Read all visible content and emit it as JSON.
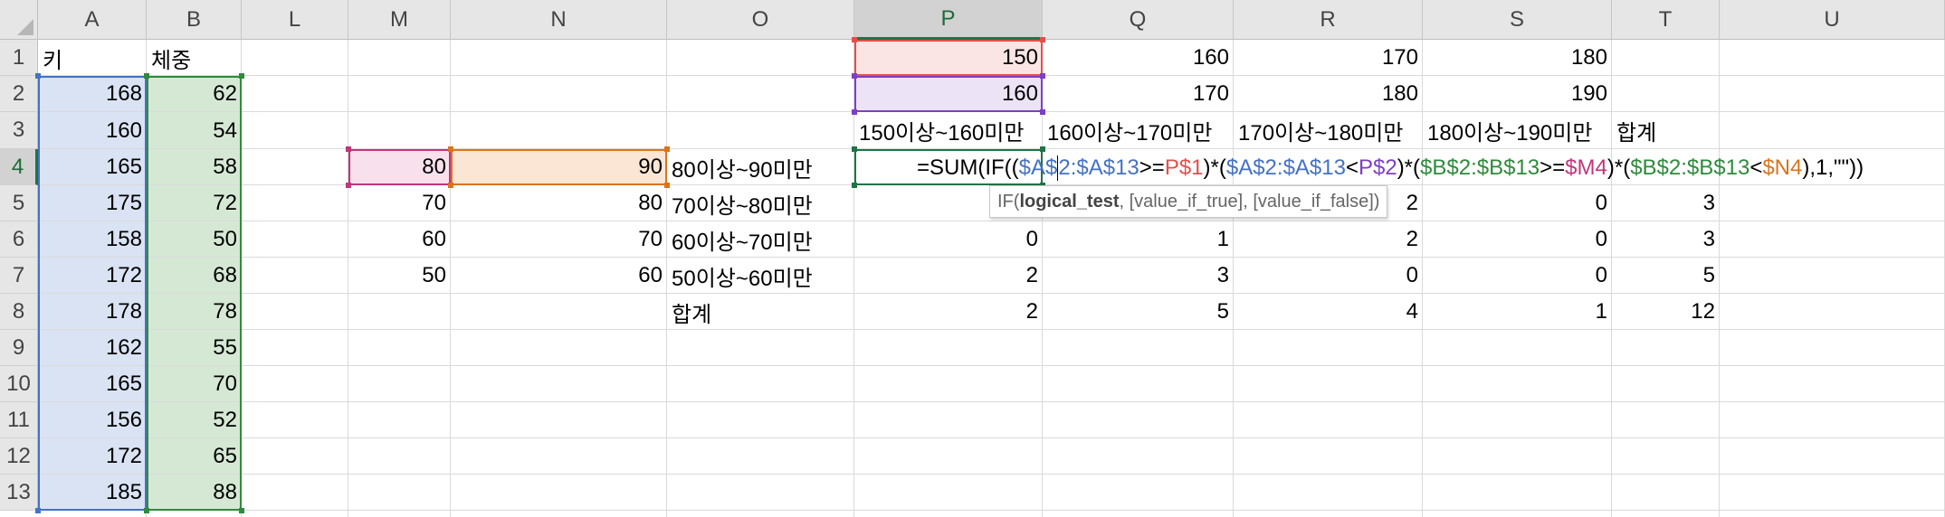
{
  "columns": [
    "A",
    "B",
    "L",
    "M",
    "N",
    "O",
    "P",
    "Q",
    "R",
    "S",
    "T",
    "U"
  ],
  "rows": [
    "1",
    "2",
    "3",
    "4",
    "5",
    "6",
    "7",
    "8",
    "9",
    "10",
    "11",
    "12",
    "13"
  ],
  "cells": {
    "A1": "키",
    "B1": "체중",
    "A2": "168",
    "B2": "62",
    "A3": "160",
    "B3": "54",
    "A4": "165",
    "B4": "58",
    "A5": "175",
    "B5": "72",
    "A6": "158",
    "B6": "50",
    "A7": "172",
    "B7": "68",
    "A8": "178",
    "B8": "78",
    "A9": "162",
    "B9": "55",
    "A10": "165",
    "B10": "70",
    "A11": "156",
    "B11": "52",
    "A12": "172",
    "B12": "65",
    "A13": "185",
    "B13": "88",
    "P1": "150",
    "Q1": "160",
    "R1": "170",
    "S1": "180",
    "P2": "160",
    "Q2": "170",
    "R2": "180",
    "S2": "190",
    "P3": "150이상~160미만",
    "Q3": "160이상~170미만",
    "R3": "170이상~180미만",
    "S3": "180이상~190미만",
    "T3": "합계",
    "M4": "80",
    "N4": "90",
    "O4": "80이상~90미만",
    "M5": "70",
    "N5": "80",
    "O5": "70이상~80미만",
    "R5": "2",
    "S5": "0",
    "T5": "3",
    "M6": "60",
    "N6": "70",
    "O6": "60이상~70미만",
    "P6": "0",
    "Q6": "1",
    "R6": "2",
    "S6": "0",
    "T6": "3",
    "M7": "50",
    "N7": "60",
    "O7": "50이상~60미만",
    "P7": "2",
    "Q7": "3",
    "R7": "0",
    "S7": "0",
    "T7": "5",
    "O8": "합계",
    "P8": "2",
    "Q8": "5",
    "R8": "4",
    "S8": "1",
    "T8": "12"
  },
  "active_cell": "P4",
  "formula": {
    "parts": [
      {
        "text": "=SUM(IF((",
        "color": "#000000"
      },
      {
        "text": "$A$",
        "color": "#4472c4"
      },
      {
        "caret": true
      },
      {
        "text": "2:$A$13",
        "color": "#4472c4"
      },
      {
        "text": ">=",
        "color": "#000000"
      },
      {
        "text": "P$1",
        "color": "#e2504c"
      },
      {
        "text": ")*(",
        "color": "#000000"
      },
      {
        "text": "$A$2:$A$13",
        "color": "#4472c4"
      },
      {
        "text": "<",
        "color": "#000000"
      },
      {
        "text": "P$2",
        "color": "#7e3fc2"
      },
      {
        "text": ")*(",
        "color": "#000000"
      },
      {
        "text": "$B$2:$B$13",
        "color": "#2e8b3a"
      },
      {
        "text": ">=",
        "color": "#000000"
      },
      {
        "text": "$M4",
        "color": "#c0367a"
      },
      {
        "text": ")*(",
        "color": "#000000"
      },
      {
        "text": "$B$2:$B$13",
        "color": "#2e8b3a"
      },
      {
        "text": "<",
        "color": "#000000"
      },
      {
        "text": "$N4",
        "color": "#d9741d"
      },
      {
        "text": "),1,\"\"))",
        "color": "#000000"
      }
    ]
  },
  "tooltip": {
    "fn": "IF(",
    "arg_bold": "logical_test",
    "rest": ", [value_if_true], [value_if_false])"
  },
  "colors": {
    "range_a": "#4472c4",
    "range_b": "#2e8b3a",
    "ref_p1": "#e2504c",
    "ref_p2": "#7e3fc2",
    "ref_m4": "#c0367a",
    "ref_n4": "#d9741d",
    "active": "#217346"
  }
}
